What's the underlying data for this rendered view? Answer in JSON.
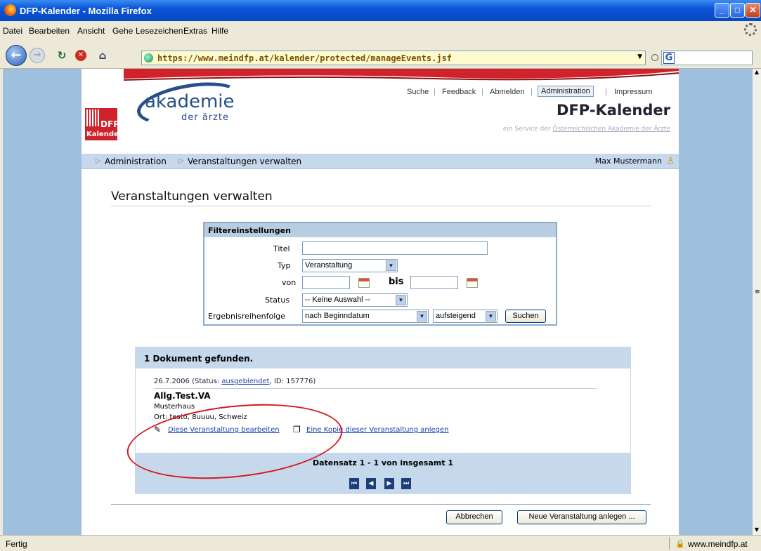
{
  "window": {
    "title": "DFP-Kalender - Mozilla Firefox"
  },
  "menu": [
    "Datei",
    "Bearbeiten",
    "Ansicht",
    "Gehe",
    "Lesezeichen",
    "Extras",
    "Hilfe"
  ],
  "nav": {
    "url": "https://www.meindfp.at/kalender/protected/manageEvents.jsf"
  },
  "status": {
    "text": "Fertig",
    "domain": "www.meindfp.at"
  },
  "header": {
    "logo_main": "akademie",
    "logo_sub": "der ärzte",
    "dfp_label": "DFP",
    "kalender_label": "Kalender",
    "topnav": [
      "Suche",
      "Feedback",
      "Abmelden",
      "Administration",
      "Impressum"
    ],
    "brand_title": "DFP-Kalender",
    "brand_sub_prefix": "ein Service der ",
    "brand_sub_link": "Österreichischen Akademie der Ärzte"
  },
  "breadcrumb": {
    "items": [
      "Administration",
      "Veranstaltungen verwalten"
    ],
    "user": "Max Mustermann"
  },
  "page_title": "Veranstaltungen verwalten",
  "filter": {
    "heading": "Filtereinstellungen",
    "titel_label": "Titel",
    "titel_value": "",
    "typ_label": "Typ",
    "typ_value": "Veranstaltung",
    "von_label": "von",
    "bis_label": "bis",
    "status_label": "Status",
    "status_value": "-- Keine Auswahl --",
    "order_label": "Ergebnisreihenfolge",
    "order_value": "nach Beginndatum",
    "direction_value": "aufsteigend",
    "search_button": "Suchen"
  },
  "results": {
    "count_text": "1 Dokument gefunden.",
    "entry": {
      "date_prefix": "26.7.2006  (Status: ",
      "status": "ausgeblendet",
      "id_suffix": ", ID: 157776)",
      "title": "Allg.Test.VA",
      "organizer": "Musterhaus",
      "location": "Ort: testo, 8uuuu, Schweiz",
      "edit_link": "Diese Veranstaltung bearbeiten",
      "copy_link": "Eine Kopie dieser Veranstaltung anlegen"
    },
    "paging_text": "Datensatz 1 - 1 von insgesamt 1"
  },
  "buttons": {
    "cancel": "Abbrechen",
    "new_event": "Neue Veranstaltung anlegen ..."
  },
  "colors": {
    "annotation": "#d6181e",
    "brand_blue": "#264f8c",
    "brand_red": "#d0222a"
  }
}
